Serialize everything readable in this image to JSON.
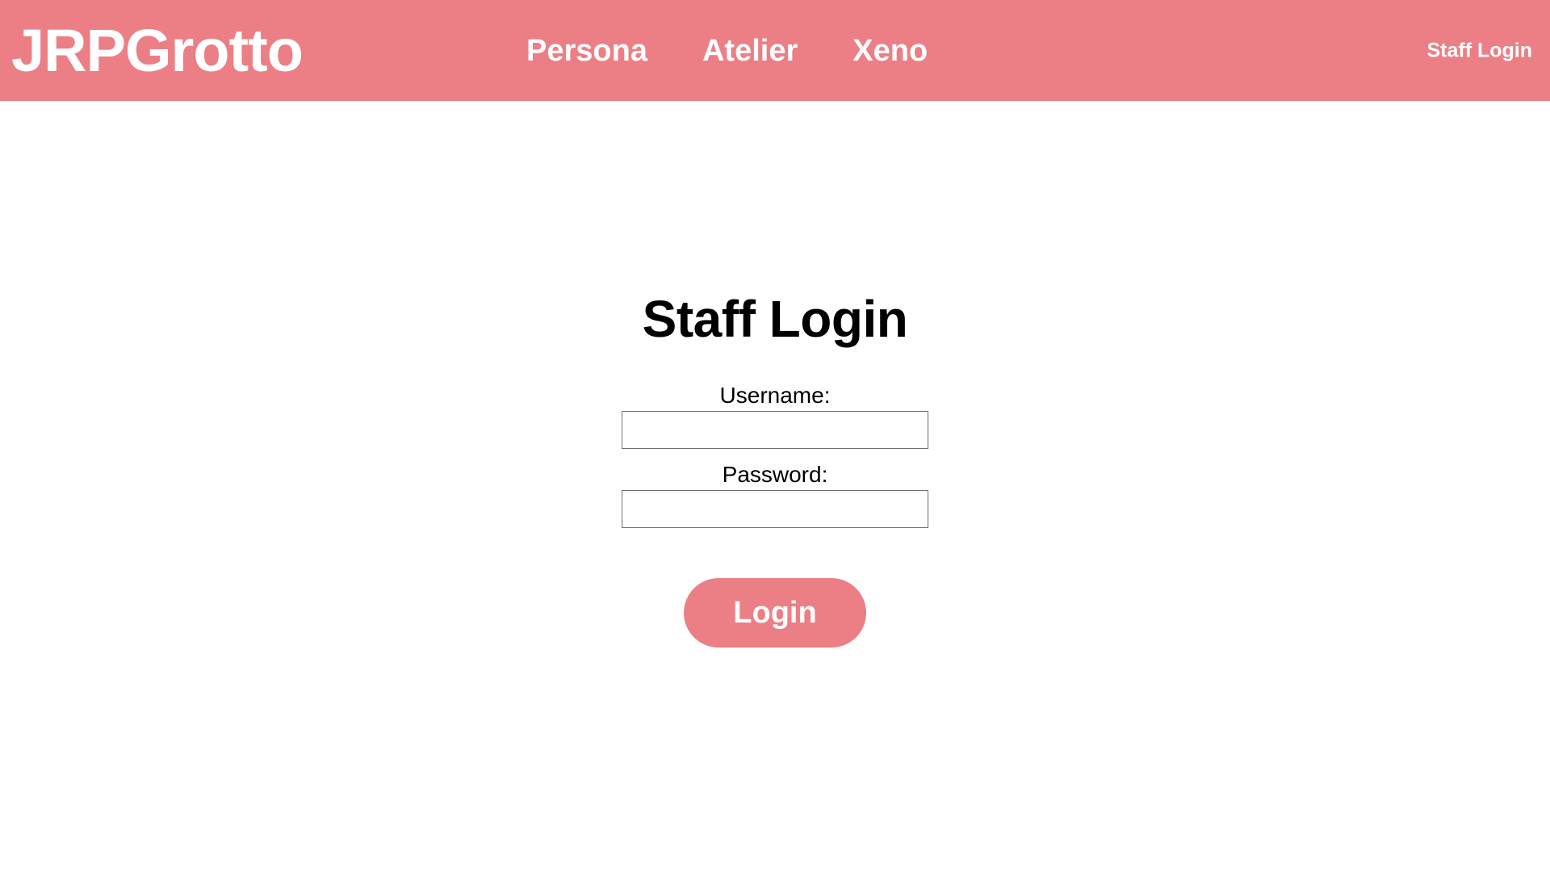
{
  "header": {
    "brand": "JRPGrotto",
    "nav_items": [
      {
        "label": "Persona"
      },
      {
        "label": "Atelier"
      },
      {
        "label": "Xeno"
      }
    ],
    "staff_login_label": "Staff Login",
    "background_color": "#ec7f85",
    "text_color": "#ffffff"
  },
  "main": {
    "title": "Staff Login",
    "form": {
      "username": {
        "label": "Username:",
        "value": "",
        "placeholder": ""
      },
      "password": {
        "label": "Password:",
        "value": "",
        "placeholder": ""
      },
      "submit_label": "Login",
      "submit_color": "#ec7f85"
    }
  }
}
